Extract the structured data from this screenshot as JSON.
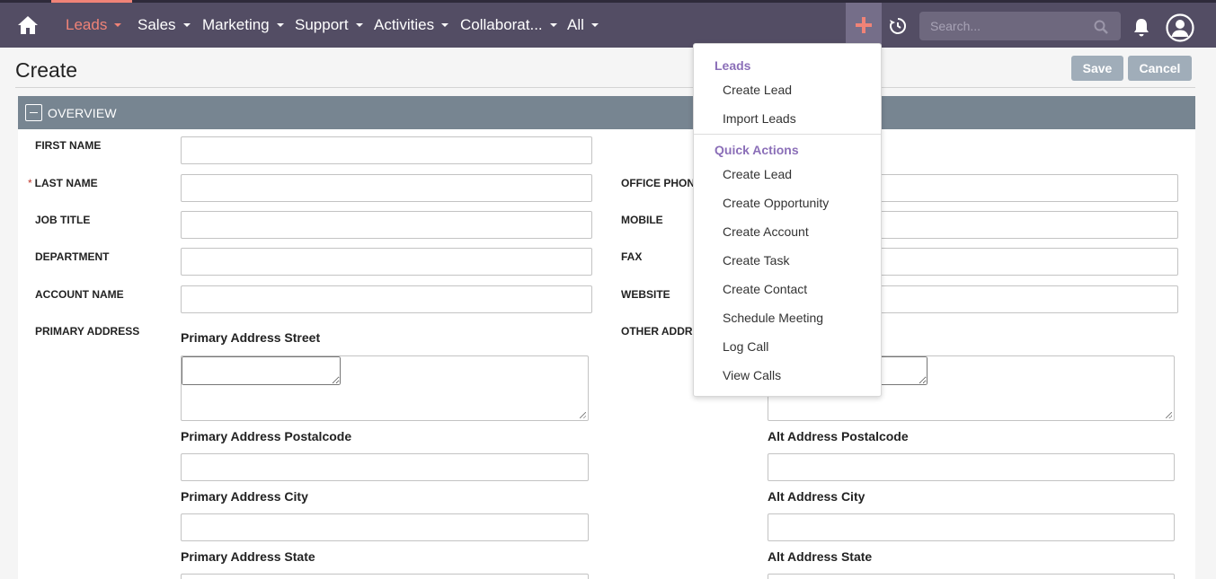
{
  "nav": {
    "items": [
      {
        "label": "Leads",
        "active": true
      },
      {
        "label": "Sales"
      },
      {
        "label": "Marketing"
      },
      {
        "label": "Support"
      },
      {
        "label": "Activities"
      },
      {
        "label": "Collaborat..."
      },
      {
        "label": "All"
      }
    ],
    "search_placeholder": "Search...",
    "icons": [
      "home-icon",
      "plus-icon",
      "history-icon",
      "search-icon",
      "bell-icon",
      "user-icon"
    ],
    "accent_color": "#f08377",
    "bar_color": "#534d64"
  },
  "page": {
    "title": "Create",
    "save_label": "Save",
    "cancel_label": "Cancel"
  },
  "panel": {
    "title": "OVERVIEW",
    "left_labels": {
      "first_name": "FIRST NAME",
      "last_name": "LAST NAME",
      "required_mark": "*",
      "job_title": "JOB TITLE",
      "department": "DEPARTMENT",
      "account_name": "ACCOUNT NAME",
      "primary_address": "PRIMARY ADDRESS"
    },
    "right_labels": {
      "office_phone": "OFFICE PHON",
      "mobile": "MOBILE",
      "fax": "FAX",
      "website": "WEBSITE",
      "other_address": "OTHER ADDR"
    },
    "primary_sub": {
      "street": "Primary Address Street",
      "postalcode": "Primary Address Postalcode",
      "city": "Primary Address City",
      "state": "Primary Address State"
    },
    "alt_sub": {
      "postalcode": "Alt Address Postalcode",
      "city": "Alt Address City",
      "state": "Alt Address State"
    }
  },
  "dropdown": {
    "leads_header": "Leads",
    "leads_items": [
      "Create Lead",
      "Import Leads"
    ],
    "quick_header": "Quick Actions",
    "quick_items": [
      "Create Lead",
      "Create Opportunity",
      "Create Account",
      "Create Task",
      "Create Contact",
      "Schedule Meeting",
      "Log Call",
      "View Calls"
    ],
    "header_color": "#8b6fb8"
  }
}
